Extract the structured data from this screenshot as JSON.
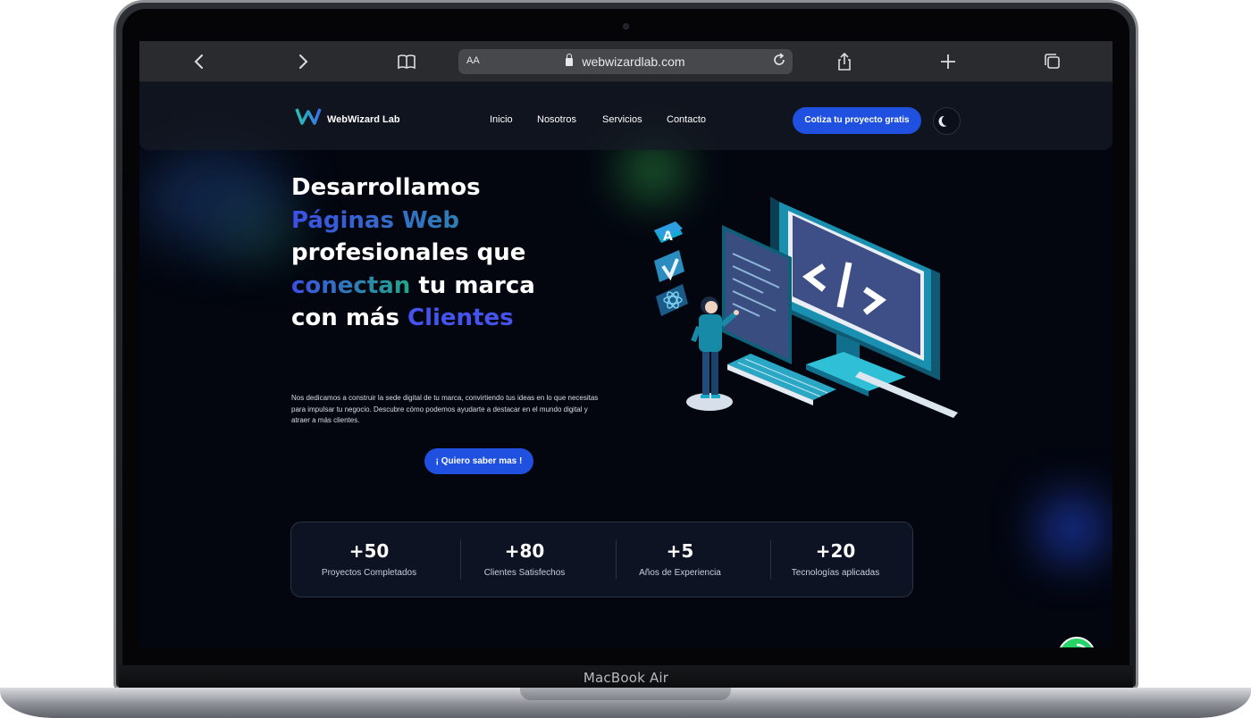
{
  "device": {
    "label": "MacBook Air"
  },
  "browser": {
    "aa_label": "AA",
    "url": "webwizardlab.com",
    "icons": [
      "chevron-left-icon",
      "chevron-right-icon",
      "book-icon",
      "lock-icon",
      "reload-icon",
      "share-icon",
      "plus-icon",
      "tabs-icon"
    ]
  },
  "site": {
    "brand": "WebWizard Lab",
    "nav": [
      "Inicio",
      "Nosotros",
      "Servicios",
      "Contacto"
    ],
    "cta_label": "Cotiza tu proyecto gratis",
    "hero": {
      "line1": "Desarrollamos",
      "line2": "Páginas Web",
      "line3": "profesionales que",
      "line4a": "conectan",
      "line4b": " tu marca",
      "line5a": "con más ",
      "line5b": "Clientes",
      "description": "Nos dedicamos a construir la sede digital de tu marca, convirtiendo tus ideas en lo que necesitas para impulsar tu negocio. Descubre cómo podemos ayudarte a destacar en el mundo digital y atraer a más clientes.",
      "button_label": "¡ Quiero saber mas !"
    },
    "stats": [
      {
        "value": "+50",
        "label": "Proyectos Completados"
      },
      {
        "value": "+80",
        "label": "Clientes Satisfechos"
      },
      {
        "value": "+5",
        "label": "Años de Experiencia"
      },
      {
        "value": "+20",
        "label": "Tecnologías aplicadas"
      }
    ],
    "colors": {
      "background": "#03060f",
      "accent_blue": "#1f50e0",
      "gradient_start": "#3c4fe6",
      "gradient_end": "#21a78c",
      "whatsapp_green": "#25d366"
    }
  }
}
